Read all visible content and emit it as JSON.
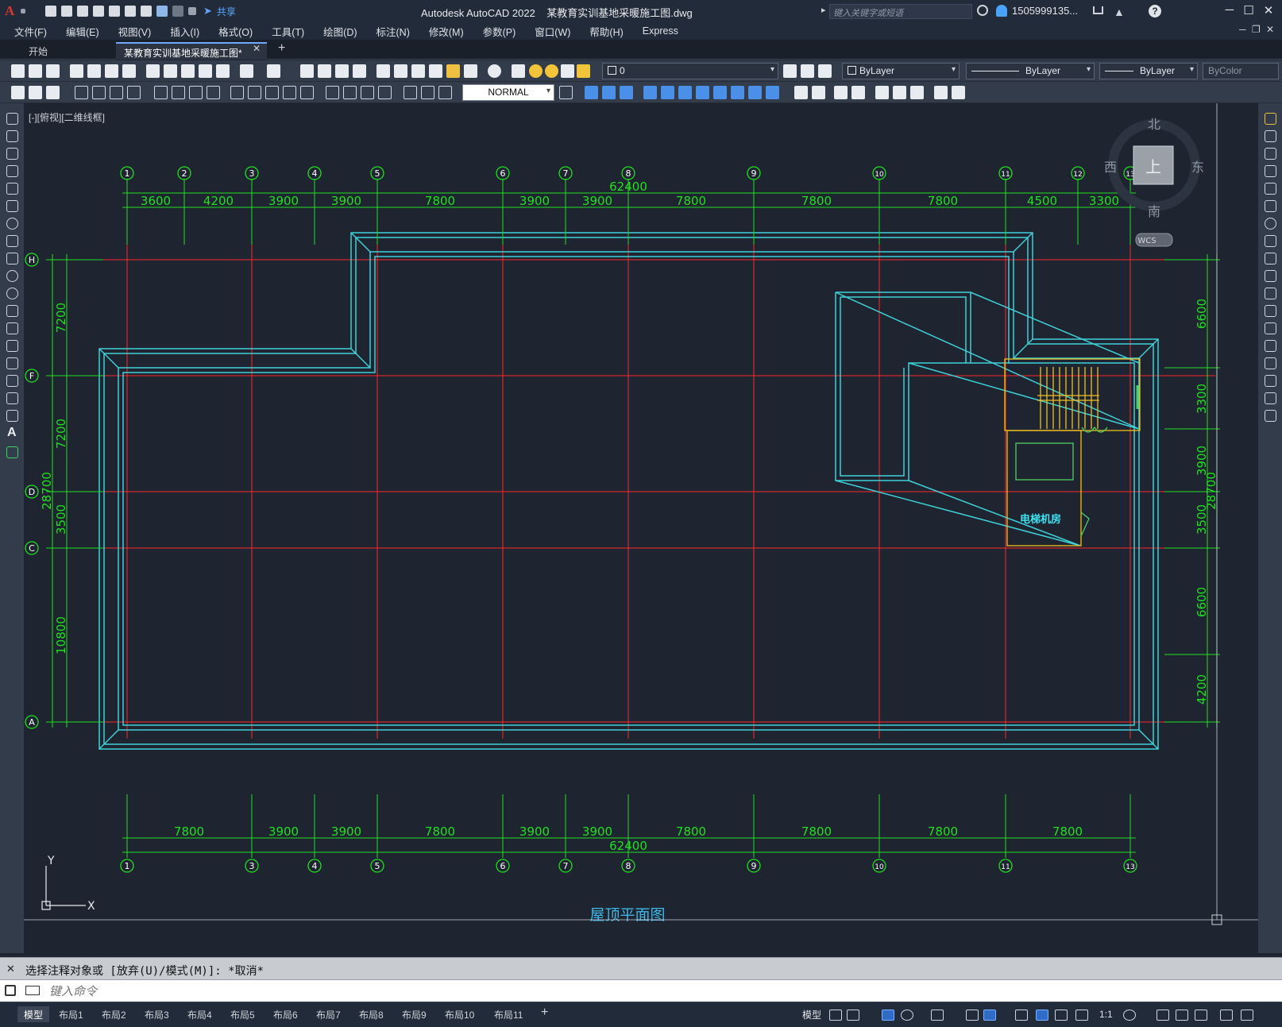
{
  "app": {
    "logo": "A",
    "title": "Autodesk AutoCAD 2022    某教育实训基地采暖施工图.dwg",
    "share": "共享",
    "search_placeholder": "键入关键字或短语",
    "user": "1505999135...",
    "help": "?"
  },
  "window_buttons": [
    "─",
    "☐",
    "✕"
  ],
  "menu": [
    "文件(F)",
    "编辑(E)",
    "视图(V)",
    "插入(I)",
    "格式(O)",
    "工具(T)",
    "绘图(D)",
    "标注(N)",
    "修改(M)",
    "参数(P)",
    "窗口(W)",
    "帮助(H)",
    "Express"
  ],
  "tabs": {
    "start": "开始",
    "doc": "某教育实训基地采暖施工图*",
    "close": "✕",
    "add": "+"
  },
  "layer_combo": "0",
  "bylayer_color": "ByLayer",
  "bylayer_linetype": "ByLayer",
  "bylayer_lineweight": "ByLayer",
  "bycolor": "ByColor",
  "text_style": "NORMAL",
  "viewport_label": "[-][俯视][二维线框]",
  "viewcube": {
    "north": "北",
    "south": "南",
    "east": "东",
    "west": "西",
    "top": "上",
    "wcs": "WCS"
  },
  "ucs": {
    "x": "X",
    "y": "Y"
  },
  "drawing": {
    "title": "屋顶平面图",
    "room_label": "电梯机房",
    "top_total": "62400",
    "bottom_total": "62400",
    "left_total": "28700",
    "right_total": "28700",
    "top_axes": [
      "1",
      "2",
      "3",
      "4",
      "5",
      "6",
      "7",
      "8",
      "9",
      "10",
      "11",
      "12",
      "13"
    ],
    "bottom_axes": [
      "1",
      "3",
      "4",
      "5",
      "6",
      "7",
      "8",
      "9",
      "10",
      "11",
      "13"
    ],
    "left_axes": [
      "H",
      "F",
      "D",
      "C",
      "A"
    ],
    "top_dims": [
      "3600",
      "4200",
      "3900",
      "3900",
      "7800",
      "3900",
      "3900",
      "7800",
      "7800",
      "7800",
      "4500",
      "3300"
    ],
    "bottom_dims": [
      "7800",
      "3900",
      "3900",
      "7800",
      "3900",
      "3900",
      "7800",
      "7800",
      "7800",
      "7800"
    ],
    "left_dims": [
      "7200",
      "7200",
      "3500",
      "10800"
    ],
    "right_dims": [
      "6600",
      "3300",
      "3900",
      "3500",
      "6600",
      "4200"
    ]
  },
  "command": {
    "history": "选择注释对象或 [放弃(U)/模式(M)]: *取消*",
    "placeholder": "键入命令",
    "close": "✕"
  },
  "layout_tabs": [
    "模型",
    "布局1",
    "布局2",
    "布局3",
    "布局4",
    "布局5",
    "布局6",
    "布局7",
    "布局8",
    "布局9",
    "布局10",
    "布局11"
  ],
  "layout_add": "+",
  "status": {
    "model": "模型",
    "scale": "1:1"
  },
  "colors": {
    "axis": "#ff2a2a",
    "dim": "#20e020",
    "wall": "#3fd0d8",
    "stair": "#f0c020",
    "title": "#3fb8e8"
  }
}
